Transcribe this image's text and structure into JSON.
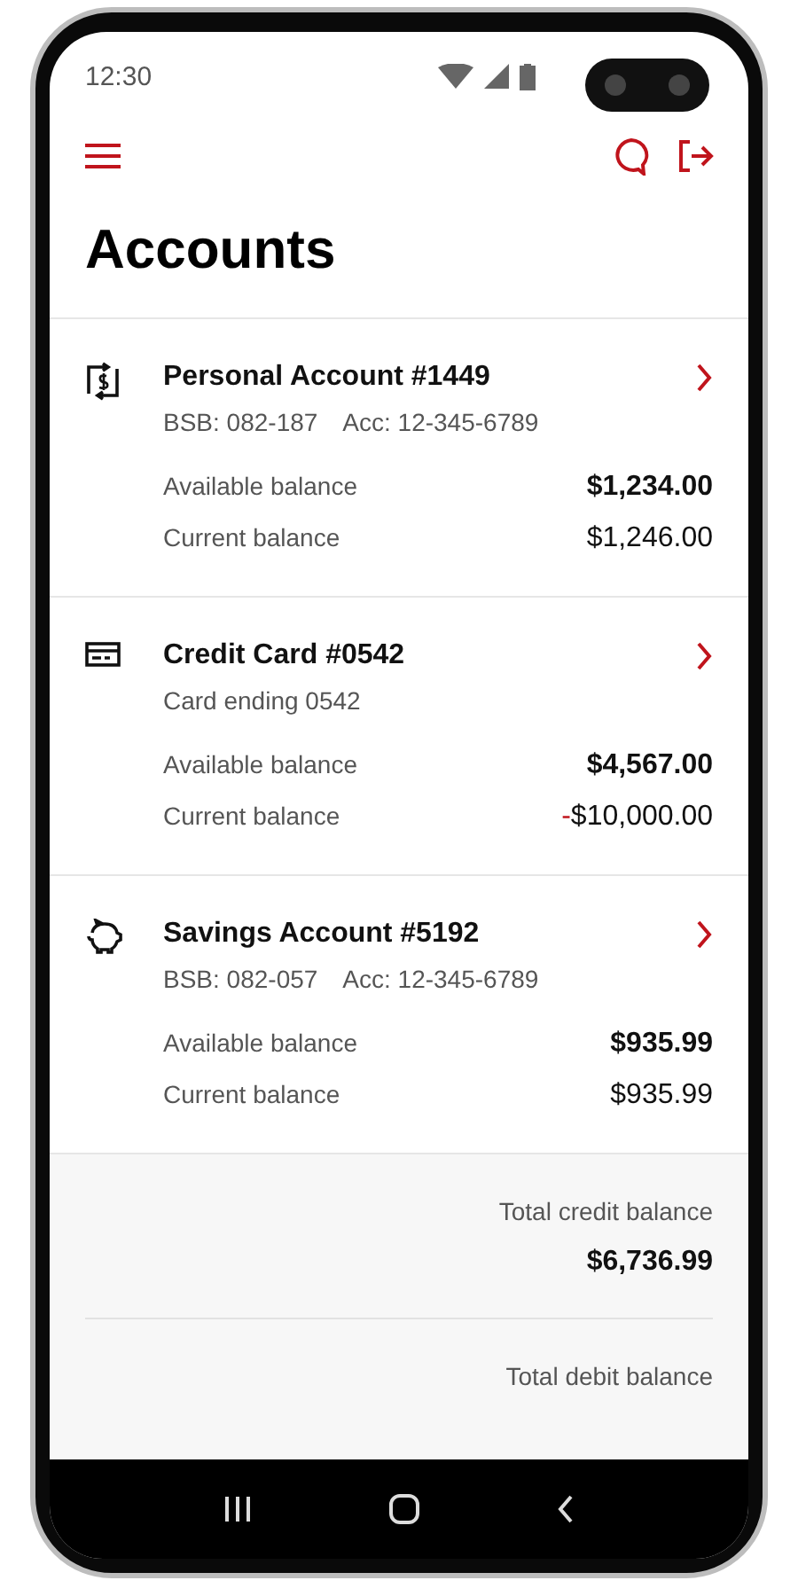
{
  "status_bar": {
    "time": "12:30"
  },
  "title": "Accounts",
  "accounts": [
    {
      "kind": "transaction",
      "name": "Personal Account #1449",
      "details": [
        "BSB: 082-187",
        "Acc: 12-345-6789"
      ],
      "balances": [
        {
          "kind": "available",
          "label": "Available balance",
          "value": "$1,234.00"
        },
        {
          "kind": "current",
          "label": "Current balance",
          "value": "$1,246.00"
        }
      ]
    },
    {
      "kind": "card",
      "name": "Credit Card #0542",
      "details": [
        "Card ending 0542"
      ],
      "balances": [
        {
          "kind": "available",
          "label": "Available balance",
          "value": "$4,567.00"
        },
        {
          "kind": "current",
          "label": "Current balance",
          "sign": "-",
          "value": "$10,000.00"
        }
      ]
    },
    {
      "kind": "savings",
      "name": "Savings Account #5192",
      "details": [
        "BSB: 082-057",
        "Acc: 12-345-6789"
      ],
      "balances": [
        {
          "kind": "available",
          "label": "Available balance",
          "value": "$935.99"
        },
        {
          "kind": "current",
          "label": "Current balance",
          "value": "$935.99"
        }
      ]
    }
  ],
  "totals": [
    {
      "label": "Total credit balance",
      "value": "$6,736.99"
    },
    {
      "label": "Total debit balance"
    }
  ]
}
